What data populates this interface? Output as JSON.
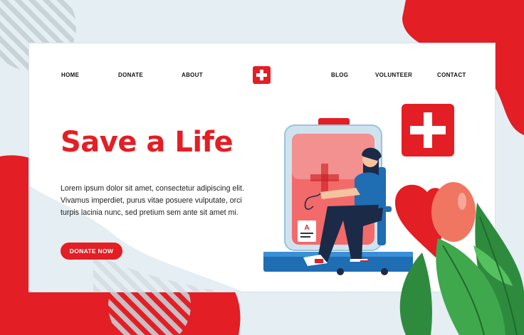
{
  "colors": {
    "accent": "#e31e24",
    "background": "#e4eef3",
    "card": "#ffffff",
    "text": "#222222"
  },
  "nav": {
    "home": "HOME",
    "donate": "DONATE",
    "about": "ABOUT",
    "blog": "BLOG",
    "volunteer": "VOLUNTEER",
    "contact": "CONTACT",
    "logo_icon": "medical-cross-icon"
  },
  "hero": {
    "title": "Save a Life",
    "description": "Lorem ipsum dolor sit amet, consectetur adipiscing elit. Vivamus imperdiet, purus vitae posuere vulputate, orci turpis lacinia nunc, sed pretium sem ante sit amet mi.",
    "cta_label": "DONATE NOW"
  },
  "illustration": {
    "blood_type": "A",
    "icons": [
      "blood-bag-icon",
      "medical-cross-icon",
      "heart-icon",
      "balloon-icon",
      "leaf-icon"
    ]
  }
}
